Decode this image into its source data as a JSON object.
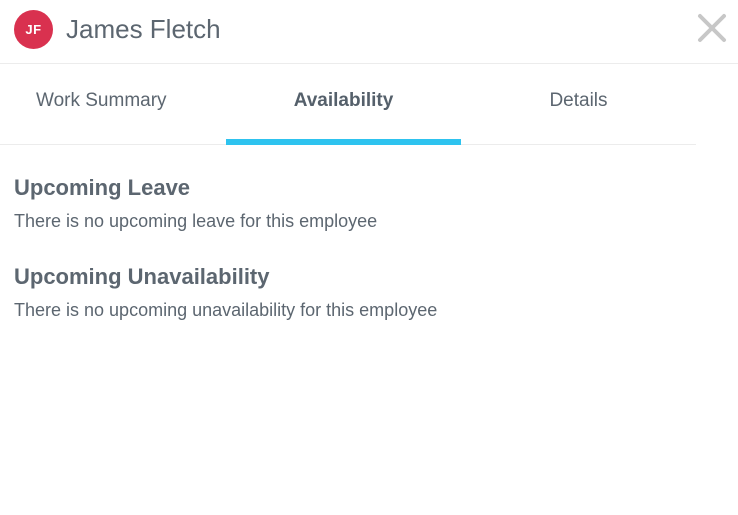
{
  "header": {
    "avatar_initials": "JF",
    "avatar_color": "#d9314f",
    "employee_name": "James Fletch",
    "close_icon": "close-icon"
  },
  "tabs": [
    {
      "label": "Work Summary",
      "active": false
    },
    {
      "label": "Availability",
      "active": true
    },
    {
      "label": "Details",
      "active": false
    }
  ],
  "accent_color": "#2ec3ef",
  "sections": {
    "upcoming_leave": {
      "title": "Upcoming Leave",
      "text": "There is no upcoming leave for this employee"
    },
    "upcoming_unavailability": {
      "title": "Upcoming Unavailability",
      "text": "There is no upcoming unavailability for this employee"
    }
  }
}
